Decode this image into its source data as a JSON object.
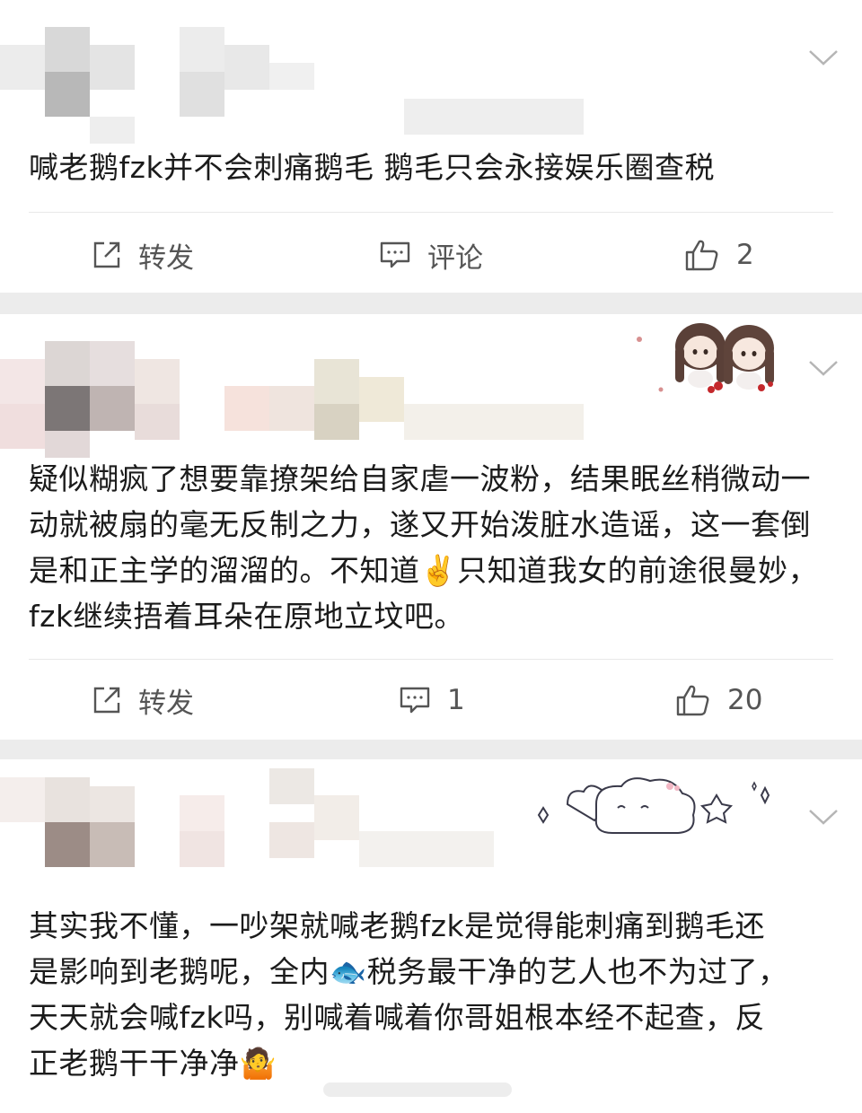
{
  "posts": [
    {
      "content": "喊老鹅fzk并不会刺痛鹅毛 鹅毛只会永接娱乐圈查税",
      "repost_label": "转发",
      "comment_label": "评论",
      "likes": "2"
    },
    {
      "content": "疑似糊疯了想要靠撩架给自家虐一波粉，结果眠丝稍微动一动就被扇的毫无反制之力，遂又开始泼脏水造谣，这一套倒是和正主学的溜溜的。不知道✌️只知道我女的前途很曼妙，fzk继续捂着耳朵在原地立坟吧。",
      "repost_label": "转发",
      "comments": "1",
      "likes": "20"
    },
    {
      "content_lines": [
        "其实我不懂，一吵架就喊老鹅fzk是觉得能刺痛到鹅毛还",
        "是影响到老鹅呢，全内🐟税务最干净的艺人也不为过了，",
        "天天就会喊fzk吗，别喊着喊着你哥姐根本经不起查，反",
        "正老鹅干干净净🤷"
      ]
    }
  ],
  "icons": {
    "repost": "repost-icon",
    "comment": "comment-icon",
    "like": "thumbs-up-icon",
    "more": "chevron-down-icon"
  }
}
